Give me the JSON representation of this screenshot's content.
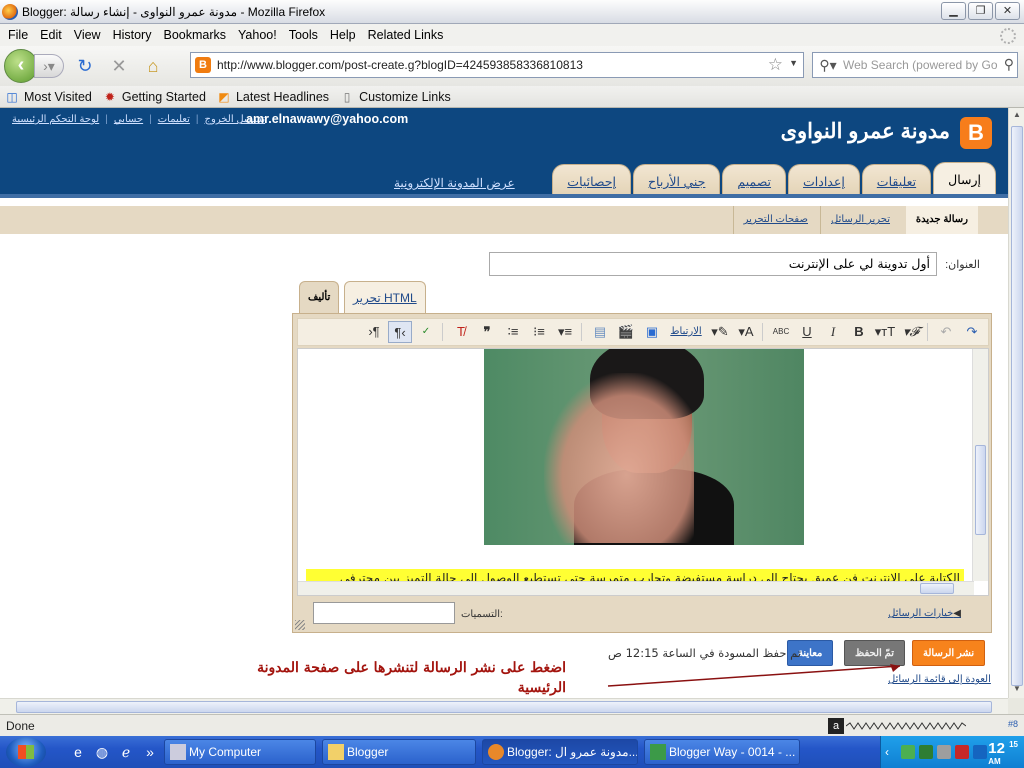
{
  "window": {
    "title": "Blogger: مدونة عمرو النواوى - إنشاء رسالة - Mozilla Firefox"
  },
  "menu": [
    "File",
    "Edit",
    "View",
    "History",
    "Bookmarks",
    "Yahoo!",
    "Tools",
    "Help",
    "Related Links"
  ],
  "nav": {
    "url": "http://www.blogger.com/post-create.g?blogID=4245938583368108​13",
    "search_placeholder": "Web Search (powered by Go"
  },
  "bookmarks": [
    "Most Visited",
    "Getting Started",
    "Latest Headlines",
    "Customize Links"
  ],
  "blogger": {
    "email": "amr.elnawawy@yahoo.com",
    "toplinks": [
      "لوحة التحكم الرئيسية",
      "حسابي",
      "تعليمات",
      "تسجيل الخروج"
    ],
    "blog_title": "مدونة عمرو النواوى",
    "logo_letter": "B",
    "view_blog": "عرض المدونة الإلكترونية",
    "tabs": [
      "إرسال",
      "تعليقات",
      "إعدادات",
      "تصميم",
      "جني الأرباح",
      "إحصائيات"
    ],
    "subtabs": [
      "رسالة جديدة",
      "تحرير الرسائل",
      "صفحات التحرير"
    ],
    "title_label": "العنوان:",
    "title_value": "أول تدوينة لي على الإنترنت",
    "editor_tabs": {
      "compose": "تأليف",
      "html": "تحرير HTML"
    },
    "toolbar_link": "الارتباط",
    "body_text": "الكتابة على الانترنت فن عميق يحتاج الى دراسة مستفيضة وتجارب متمرسة حتى تستطيع الوصول الى حالة التميز بين محترفي",
    "post_options": "خيارات الرسائل",
    "labels_label": "التسميات:",
    "btn_publish": "نشر الرسالة",
    "btn_saved": "تمّ الحفظ",
    "btn_preview": "معاينة",
    "draft_status": "تم حفظ المسودة في الساعة 12:15 ص",
    "return_link": "العودة إلى قائمة الرسائل",
    "annotation": "اضغط على نشر الرسالة لتنشرها على صفحة المدونة الرئيسية"
  },
  "status": {
    "text": "Done",
    "meter": "#8"
  },
  "taskbar": {
    "tasks": [
      "My Computer",
      "Blogger",
      "Blogger: مدونة عمرو ال...",
      "Blogger Way - 0014 - ..."
    ],
    "clock_hour": "12",
    "clock_min": "15",
    "clock_ampm": "AM"
  },
  "colors": {
    "header_blue": "#0d4780",
    "publish_orange": "#f7831c",
    "annotation_red": "#a3140e",
    "highlight_yellow": "#ffff33"
  }
}
